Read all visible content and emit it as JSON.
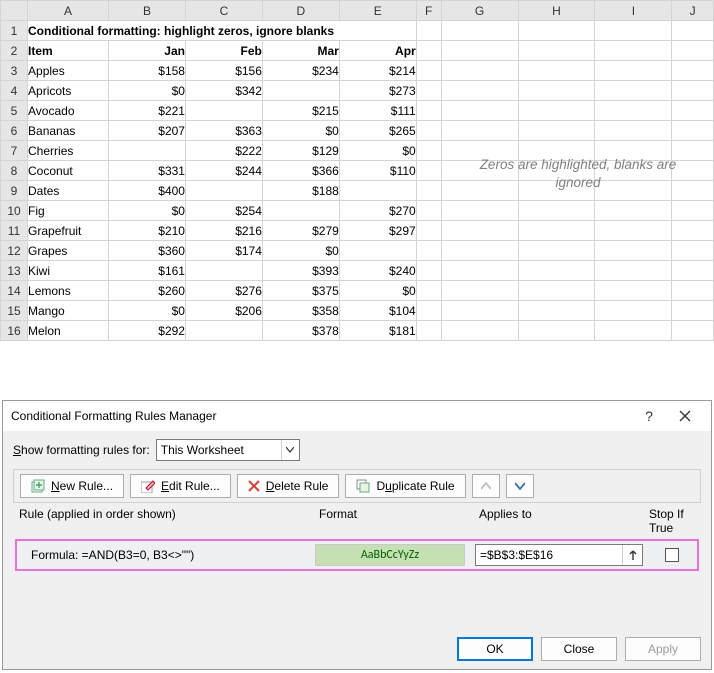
{
  "sheet": {
    "title": "Conditional formatting: highlight zeros, ignore blanks",
    "columns": [
      "A",
      "B",
      "C",
      "D",
      "E",
      "F",
      "G",
      "H",
      "I",
      "J"
    ],
    "headers": {
      "item": "Item",
      "jan": "Jan",
      "feb": "Feb",
      "mar": "Mar",
      "apr": "Apr"
    },
    "rows": [
      {
        "n": 3,
        "item": "Apples",
        "jan": "$158",
        "feb": "$156",
        "mar": "$234",
        "apr": "$214"
      },
      {
        "n": 4,
        "item": "Apricots",
        "jan": "$0",
        "feb": "$342",
        "mar": "",
        "apr": "$273"
      },
      {
        "n": 5,
        "item": "Avocado",
        "jan": "$221",
        "feb": "",
        "mar": "$215",
        "apr": "$111"
      },
      {
        "n": 6,
        "item": "Bananas",
        "jan": "$207",
        "feb": "$363",
        "mar": "$0",
        "apr": "$265"
      },
      {
        "n": 7,
        "item": "Cherries",
        "jan": "",
        "feb": "$222",
        "mar": "$129",
        "apr": "$0"
      },
      {
        "n": 8,
        "item": "Coconut",
        "jan": "$331",
        "feb": "$244",
        "mar": "$366",
        "apr": "$110"
      },
      {
        "n": 9,
        "item": "Dates",
        "jan": "$400",
        "feb": "",
        "mar": "$188",
        "apr": ""
      },
      {
        "n": 10,
        "item": "Fig",
        "jan": "$0",
        "feb": "$254",
        "mar": "",
        "apr": "$270"
      },
      {
        "n": 11,
        "item": "Grapefruit",
        "jan": "$210",
        "feb": "$216",
        "mar": "$279",
        "apr": "$297"
      },
      {
        "n": 12,
        "item": "Grapes",
        "jan": "$360",
        "feb": "$174",
        "mar": "$0",
        "apr": ""
      },
      {
        "n": 13,
        "item": "Kiwi",
        "jan": "$161",
        "feb": "",
        "mar": "$393",
        "apr": "$240"
      },
      {
        "n": 14,
        "item": "Lemons",
        "jan": "$260",
        "feb": "$276",
        "mar": "$375",
        "apr": "$0"
      },
      {
        "n": 15,
        "item": "Mango",
        "jan": "$0",
        "feb": "$206",
        "mar": "$358",
        "apr": "$104"
      },
      {
        "n": 16,
        "item": "Melon",
        "jan": "$292",
        "feb": "",
        "mar": "$378",
        "apr": "$181"
      }
    ],
    "note": "Zeros are highlighted, blanks are ignored"
  },
  "dialog": {
    "title": "Conditional Formatting Rules Manager",
    "rules_for_label": "Show formatting rules for:",
    "rules_for_value": "This Worksheet",
    "toolbar": {
      "new": "New Rule...",
      "edit": "Edit Rule...",
      "delete": "Delete Rule",
      "duplicate": "Duplicate Rule"
    },
    "cols": {
      "rule": "Rule (applied in order shown)",
      "format": "Format",
      "applies": "Applies to",
      "stop": "Stop If True"
    },
    "rule": {
      "text": "Formula: =AND(B3=0, B3<>\"\")",
      "preview": "AaBbCcYyZz",
      "applies": "=$B$3:$E$16"
    },
    "buttons": {
      "ok": "OK",
      "close": "Close",
      "apply": "Apply"
    }
  }
}
